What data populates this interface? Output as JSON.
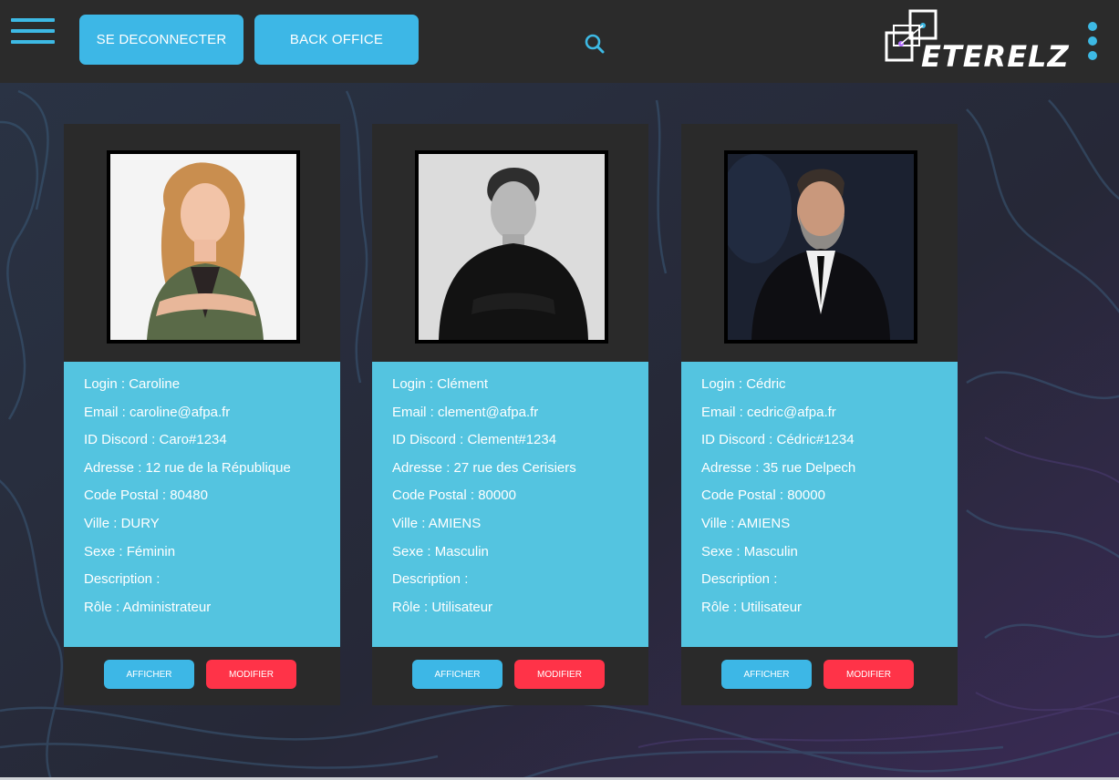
{
  "header": {
    "logout_label": "SE DECONNECTER",
    "backoffice_label": "BACK OFFICE",
    "logo_text": "ETERELZ"
  },
  "colors": {
    "accent": "#3db7e6",
    "danger": "#ff3348",
    "info_panel": "#54c4e0",
    "card_bg": "#2a2a2a",
    "topbar_bg": "#2b2b2b"
  },
  "icons": {
    "menu": "hamburger-menu-icon",
    "search": "search-icon",
    "more": "more-vertical-icon"
  },
  "users": [
    {
      "photo": "portrait-caroline",
      "login": "Login : Caroline",
      "email": "Email : caroline@afpa.fr",
      "discord": "ID Discord : Caro#1234",
      "address": "Adresse : 12 rue de la République",
      "postal": "Code Postal : 80480",
      "city": "Ville : DURY",
      "sex": "Sexe : Féminin",
      "description": "Description :",
      "role": "Rôle : Administrateur",
      "show_label": "AFFICHER",
      "edit_label": "MODIFIER"
    },
    {
      "photo": "portrait-clement",
      "login": "Login : Clément",
      "email": "Email : clement@afpa.fr",
      "discord": "ID Discord : Clement#1234",
      "address": "Adresse : 27 rue des Cerisiers",
      "postal": "Code Postal : 80000",
      "city": "Ville : AMIENS",
      "sex": "Sexe : Masculin",
      "description": "Description :",
      "role": "Rôle : Utilisateur",
      "show_label": "AFFICHER",
      "edit_label": "MODIFIER"
    },
    {
      "photo": "portrait-cedric",
      "login": "Login : Cédric",
      "email": "Email : cedric@afpa.fr",
      "discord": "ID Discord : Cédric#1234",
      "address": "Adresse : 35 rue Delpech",
      "postal": "Code Postal : 80000",
      "city": "Ville : AMIENS",
      "sex": "Sexe : Masculin",
      "description": "Description :",
      "role": "Rôle : Utilisateur",
      "show_label": "AFFICHER",
      "edit_label": "MODIFIER"
    }
  ]
}
